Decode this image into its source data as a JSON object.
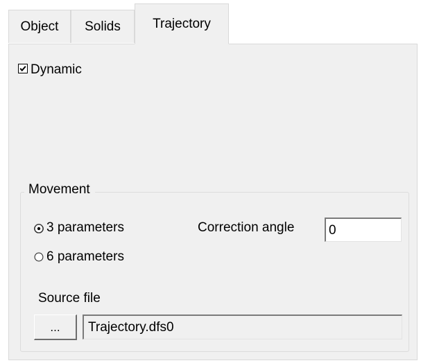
{
  "tabs": [
    {
      "label": "Object",
      "active": false
    },
    {
      "label": "Solids",
      "active": false
    },
    {
      "label": "Trajectory",
      "active": true
    }
  ],
  "dynamic": {
    "label": "Dynamic",
    "checked": true
  },
  "movement": {
    "title": "Movement",
    "options": [
      {
        "label": "3 parameters",
        "selected": true
      },
      {
        "label": "6 parameters",
        "selected": false
      }
    ],
    "correction_angle": {
      "label": "Correction angle",
      "value": "0"
    },
    "source_file": {
      "label": "Source file",
      "browse_label": "...",
      "value": "Trajectory.dfs0"
    }
  }
}
